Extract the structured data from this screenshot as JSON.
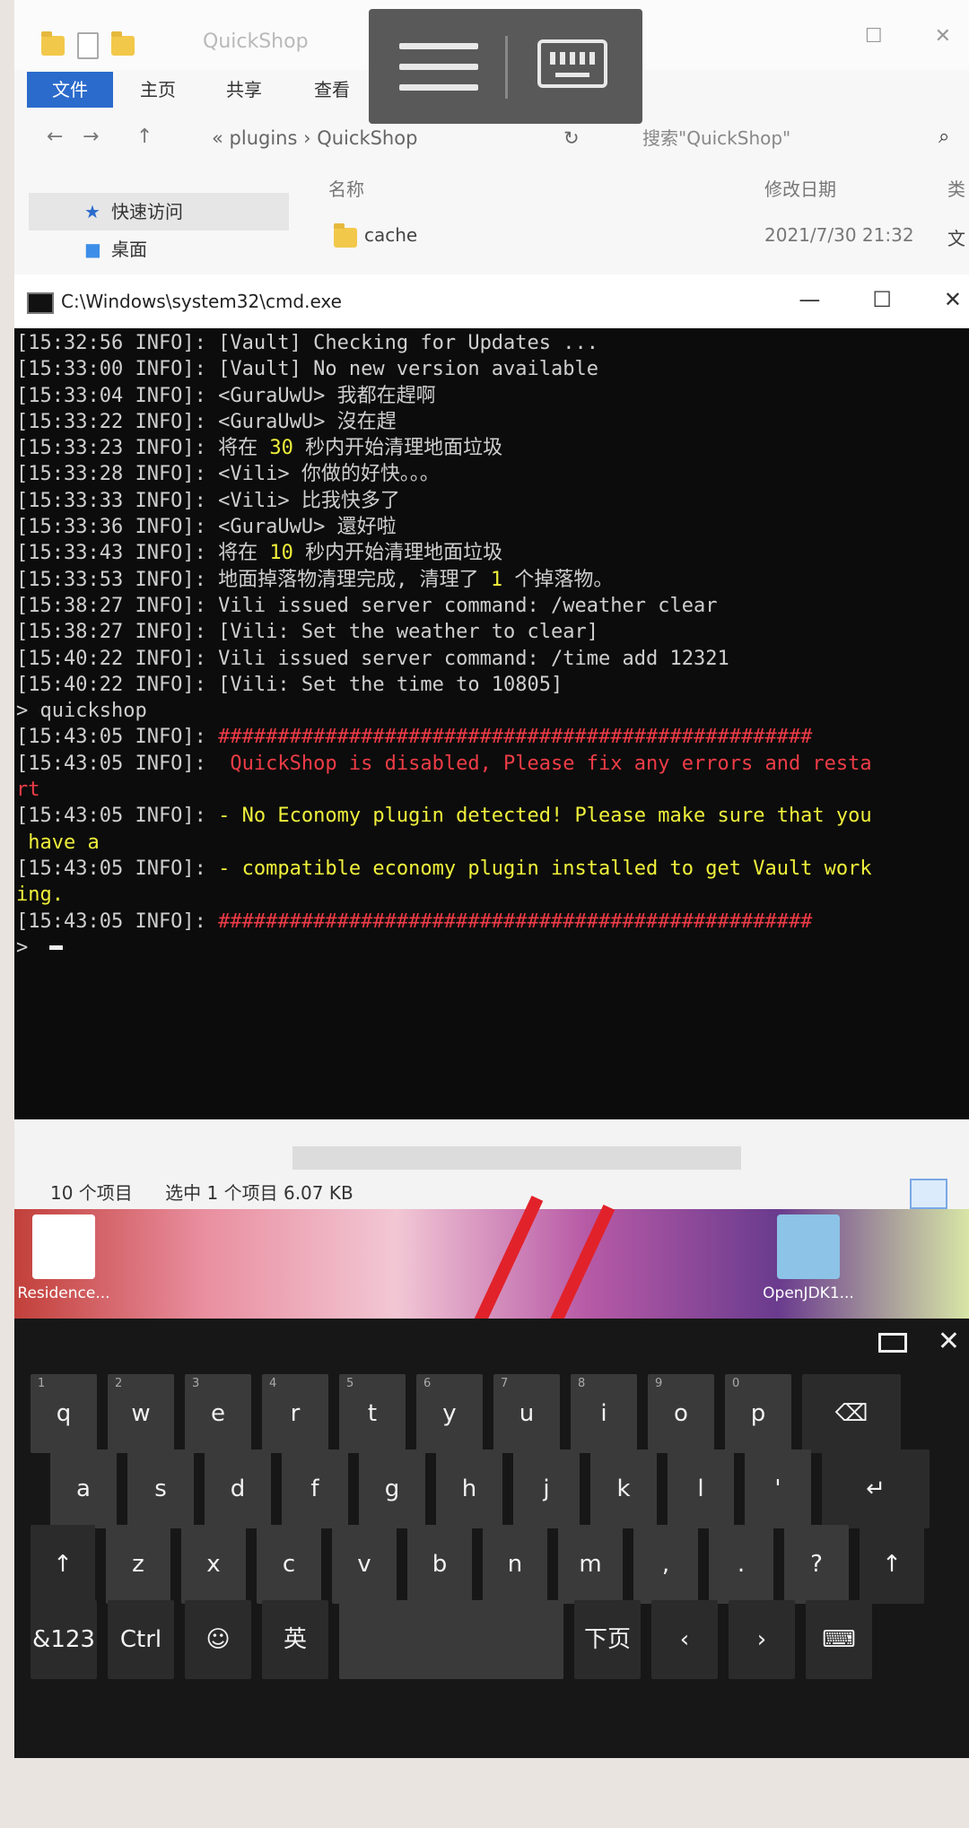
{
  "explorer": {
    "title": "QuickShop",
    "ribbon_tabs": [
      "文件",
      "主页",
      "共享",
      "查看"
    ],
    "address": [
      "«",
      "plugins",
      "›",
      "QuickShop"
    ],
    "search_placeholder": "搜索\"QuickShop\"",
    "nav_items": [
      "快速访问",
      "桌面"
    ],
    "columns": {
      "name": "名称",
      "modified": "修改日期",
      "type": "类"
    },
    "files": [
      {
        "name": "cache",
        "modified": "2021/7/30 21:32",
        "type": "文"
      }
    ],
    "status_count": "10 个项目",
    "status_selected": "选中 1 个项目  6.07 KB"
  },
  "cmd": {
    "title": "C:\\Windows\\system32\\cmd.exe",
    "lines": [
      {
        "prefix": "[15:32:56 INFO]: ",
        "parts": [
          {
            "t": "[Vault] Checking for Updates ..."
          }
        ]
      },
      {
        "prefix": "[15:33:00 INFO]: ",
        "parts": [
          {
            "t": "[Vault] No new version available"
          }
        ]
      },
      {
        "prefix": "[15:33:04 INFO]: ",
        "parts": [
          {
            "t": "<GuraUwU> 我都在趕啊"
          }
        ]
      },
      {
        "prefix": "[15:33:22 INFO]: ",
        "parts": [
          {
            "t": "<GuraUwU> 沒在趕"
          }
        ]
      },
      {
        "prefix": "[15:33:23 INFO]: ",
        "parts": [
          {
            "t": "将在 "
          },
          {
            "t": "30",
            "c": "y"
          },
          {
            "t": " 秒内开始清理地面垃圾"
          }
        ]
      },
      {
        "prefix": "[15:33:28 INFO]: ",
        "parts": [
          {
            "t": "<Vili> 你做的好快。。。"
          }
        ]
      },
      {
        "prefix": "[15:33:33 INFO]: ",
        "parts": [
          {
            "t": "<Vili> 比我快多了"
          }
        ]
      },
      {
        "prefix": "[15:33:36 INFO]: ",
        "parts": [
          {
            "t": "<GuraUwU> 還好啦"
          }
        ]
      },
      {
        "prefix": "[15:33:43 INFO]: ",
        "parts": [
          {
            "t": "将在 "
          },
          {
            "t": "10",
            "c": "y"
          },
          {
            "t": " 秒内开始清理地面垃圾"
          }
        ]
      },
      {
        "prefix": "[15:33:53 INFO]: ",
        "parts": [
          {
            "t": "地面掉落物清理完成, 清理了 "
          },
          {
            "t": "1",
            "c": "y"
          },
          {
            "t": " 个掉落物。"
          }
        ]
      },
      {
        "prefix": "[15:38:27 INFO]: ",
        "parts": [
          {
            "t": "Vili issued server command: /weather clear"
          }
        ]
      },
      {
        "prefix": "[15:38:27 INFO]: ",
        "parts": [
          {
            "t": "[Vili: Set the weather to clear]"
          }
        ]
      },
      {
        "prefix": "[15:40:22 INFO]: ",
        "parts": [
          {
            "t": "Vili issued server command: /time add 12321"
          }
        ]
      },
      {
        "prefix": "[15:40:22 INFO]: ",
        "parts": [
          {
            "t": "[Vili: Set the time to 10805]"
          }
        ]
      },
      {
        "prefix": "> ",
        "parts": [
          {
            "t": "quickshop"
          }
        ]
      },
      {
        "prefix": "[15:43:05 INFO]: ",
        "parts": [
          {
            "t": "##################################################",
            "c": "r"
          }
        ]
      },
      {
        "prefix": "[15:43:05 INFO]: ",
        "parts": [
          {
            "t": " QuickShop is disabled, Please fix any errors and resta",
            "c": "r"
          }
        ]
      },
      {
        "prefix": "",
        "parts": [
          {
            "t": "rt",
            "c": "r"
          }
        ]
      },
      {
        "prefix": "[15:43:05 INFO]: ",
        "parts": [
          {
            "t": "- No Economy plugin detected! Please make sure that you",
            "c": "y"
          }
        ]
      },
      {
        "prefix": "",
        "parts": [
          {
            "t": " have a",
            "c": "y"
          }
        ]
      },
      {
        "prefix": "[15:43:05 INFO]: ",
        "parts": [
          {
            "t": "- compatible economy plugin installed to get Vault work",
            "c": "y"
          }
        ]
      },
      {
        "prefix": "",
        "parts": [
          {
            "t": "ing.",
            "c": "y"
          }
        ]
      },
      {
        "prefix": "[15:43:05 INFO]: ",
        "parts": [
          {
            "t": "##################################################",
            "c": "r"
          }
        ]
      },
      {
        "prefix": "> ",
        "parts": [],
        "cursor": true
      }
    ]
  },
  "desktop": {
    "icons": [
      "Residence...",
      "OpenJDK1..."
    ]
  },
  "keyboard": {
    "rows": [
      [
        {
          "k": "q",
          "n": "1"
        },
        {
          "k": "w",
          "n": "2"
        },
        {
          "k": "e",
          "n": "3"
        },
        {
          "k": "r",
          "n": "4"
        },
        {
          "k": "t",
          "n": "5"
        },
        {
          "k": "y",
          "n": "6"
        },
        {
          "k": "u",
          "n": "7"
        },
        {
          "k": "i",
          "n": "8"
        },
        {
          "k": "o",
          "n": "9"
        },
        {
          "k": "p",
          "n": "0"
        },
        {
          "k": "⌫"
        }
      ],
      [
        {
          "k": "a"
        },
        {
          "k": "s"
        },
        {
          "k": "d"
        },
        {
          "k": "f"
        },
        {
          "k": "g"
        },
        {
          "k": "h"
        },
        {
          "k": "j"
        },
        {
          "k": "k"
        },
        {
          "k": "l"
        },
        {
          "k": "'"
        },
        {
          "k": "↵"
        }
      ],
      [
        {
          "k": "↑"
        },
        {
          "k": "z"
        },
        {
          "k": "x"
        },
        {
          "k": "c"
        },
        {
          "k": "v"
        },
        {
          "k": "b"
        },
        {
          "k": "n"
        },
        {
          "k": "m"
        },
        {
          "k": ","
        },
        {
          "k": "."
        },
        {
          "k": "?"
        },
        {
          "k": "↑"
        }
      ],
      [
        {
          "k": "&123"
        },
        {
          "k": "Ctrl"
        },
        {
          "k": "☺"
        },
        {
          "k": "英"
        },
        {
          "k": ""
        },
        {
          "k": "下页"
        },
        {
          "k": "‹"
        },
        {
          "k": "›"
        },
        {
          "k": "⌨"
        }
      ]
    ]
  }
}
